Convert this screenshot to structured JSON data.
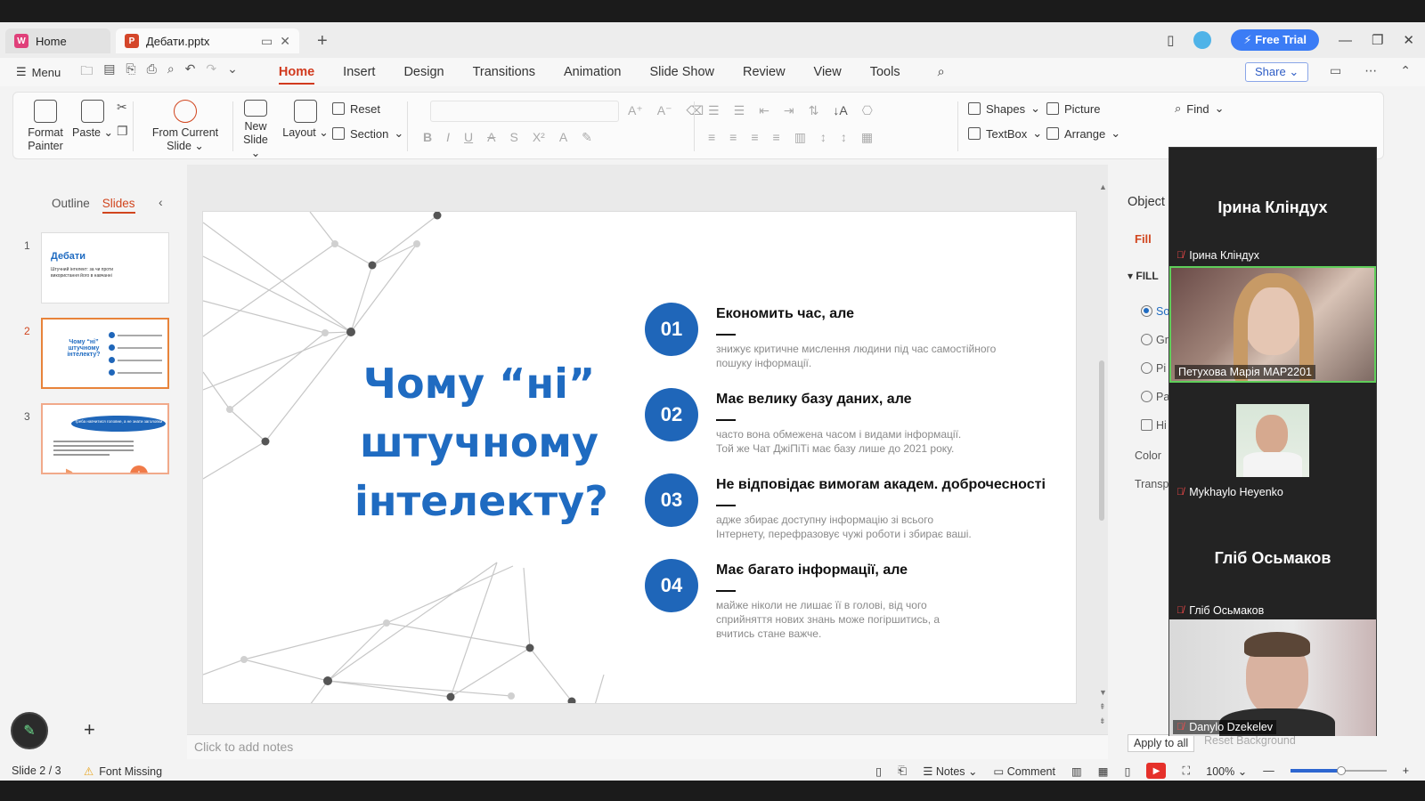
{
  "tabs": {
    "home_label": "Home",
    "doc_label": "Дебати.pptx",
    "free_trial": "Free Trial"
  },
  "menubar": {
    "menu_label": "Menu",
    "tabs": [
      "Home",
      "Insert",
      "Design",
      "Transitions",
      "Animation",
      "Slide Show",
      "Review",
      "View",
      "Tools"
    ],
    "active_tab": "Home",
    "share": "Share"
  },
  "ribbon": {
    "format_painter_1": "Format",
    "format_painter_2": "Painter",
    "paste": "Paste",
    "from_current_1": "From Current",
    "from_current_2": "Slide",
    "new_slide_1": "New",
    "new_slide_2": "Slide",
    "layout": "Layout",
    "reset": "Reset",
    "section": "Section",
    "shapes": "Shapes",
    "picture": "Picture",
    "find": "Find",
    "textbox": "TextBox",
    "arrange": "Arrange"
  },
  "leftpanel": {
    "outline_tab": "Outline",
    "slides_tab": "Slides",
    "thumb1_title": "Дебати",
    "thumb1_sub": "Штучний інтелект: за чи проти використання його в навчанні",
    "thumb2_title": "Чому “ні” штучному інтелекту?",
    "thumb3_banner": "Треба навчитися головне, а не знати заголовки"
  },
  "slide": {
    "title": "Чому “ні” штучному інтелекту?",
    "items": [
      {
        "num": "01",
        "head": "Економить час, але",
        "body1": "знижує критичне мислення людини під час самостійного",
        "body2": "пошуку інформації."
      },
      {
        "num": "02",
        "head": "Має  велику базу даних, але",
        "body1": "часто вона обмежена часом і видами інформації.",
        "body2": "Той же Чат ДжіПіТі має базу лише до 2021 року."
      },
      {
        "num": "03",
        "head": "Не відповідає вимогам академ. доброчесності",
        "body1": "адже збирає доступну інформацію зі всього",
        "body2": "Інтернету, перефразовує чужі роботи і збирає ваші."
      },
      {
        "num": "04",
        "head": "Має багато інформації, але",
        "body1": "майже ніколи не лишає її в голові, від чого",
        "body2": "сприйняття нових знань може погіршитись, а",
        "body3": "вчитись стане важче."
      }
    ],
    "notes_placeholder": "Click to add notes"
  },
  "rightpanel": {
    "title": "Object",
    "fill_tab": "Fill",
    "fill_header": "FILL",
    "options": [
      "So",
      "Gr",
      "Pi",
      "Pa",
      "Hi"
    ],
    "color_label": "Color",
    "transparency_label": "Transp",
    "apply_all": "Apply to all",
    "reset_bg": "Reset Background"
  },
  "zoom": {
    "participants": [
      {
        "big_name": "Ірина Кліндух",
        "label": "Ірина Кліндух"
      },
      {
        "label": "Петухова Марія МАР2201"
      },
      {
        "label": "Mykhaylo Heyenko"
      },
      {
        "big_name": "Гліб Осьмаков",
        "label": "Гліб Осьмаков"
      },
      {
        "label": "Danylo Dzekelev"
      }
    ]
  },
  "status": {
    "slide_pos": "Slide 2 / 3",
    "font_missing": "Font Missing",
    "notes": "Notes",
    "comment": "Comment",
    "zoom": "100%"
  }
}
